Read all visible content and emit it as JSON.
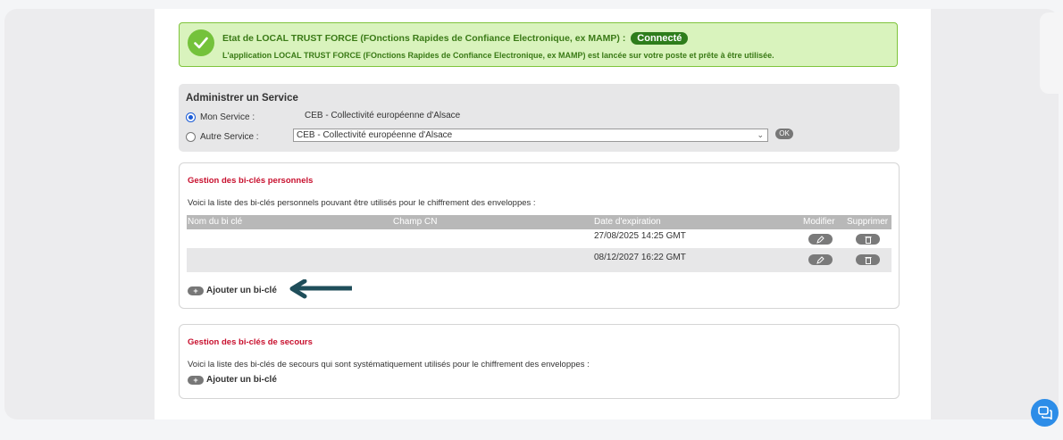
{
  "status": {
    "line1": "Etat de LOCAL TRUST FORCE (FOnctions Rapides de Confiance Electronique, ex MAMP) :",
    "badge": "Connecté",
    "line2": "L'application LOCAL TRUST FORCE (FOnctions Rapides de Confiance Electronique, ex MAMP) est lancée sur votre poste et prête à être utilisée.",
    "color": "#74c23b"
  },
  "admin": {
    "title": "Administrer un Service",
    "mon_service_label": "Mon Service :",
    "mon_service_value": "CEB - Collectivité européenne d'Alsace",
    "autre_service_label": "Autre Service :",
    "autre_service_selected": "CEB - Collectivité européenne d'Alsace",
    "ok_label": "OK"
  },
  "personal_keys": {
    "title": "Gestion des bi-clés personnels",
    "description": "Voici la liste des bi-clés personnels pouvant être utilisés pour le chiffrement des enveloppes :",
    "columns": {
      "name": "Nom du bi clé",
      "cn": "Champ CN",
      "expiry": "Date d'expiration",
      "modify": "Modifier",
      "delete": "Supprimer"
    },
    "rows": [
      {
        "name": "",
        "cn": "",
        "expiry": "27/08/2025 14:25 GMT"
      },
      {
        "name": "",
        "cn": "",
        "expiry": "08/12/2027 16:22 GMT"
      }
    ],
    "add_label": "Ajouter un bi-clé"
  },
  "backup_keys": {
    "title": "Gestion des bi-clés de secours",
    "description": "Voici la liste des bi-clés de secours qui sont systématiquement utilisés pour le chiffrement des enveloppes :",
    "add_label": "Ajouter un bi-clé"
  },
  "colors": {
    "accent_red": "#c8102e",
    "arrow": "#1f4e5a",
    "chat": "#2d8de8"
  }
}
